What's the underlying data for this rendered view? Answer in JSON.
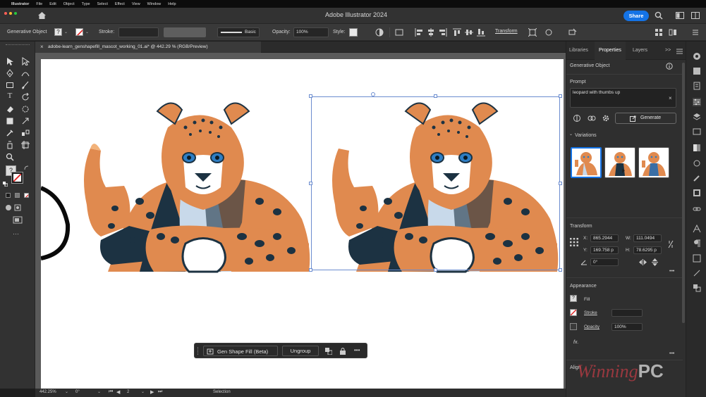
{
  "menubar": {
    "apple": "",
    "items": [
      "Illustrator",
      "File",
      "Edit",
      "Object",
      "Type",
      "Select",
      "Effect",
      "View",
      "Window",
      "Help"
    ]
  },
  "titlebar": {
    "title": "Adobe Illustrator 2024",
    "share_label": "Share"
  },
  "control_bar": {
    "selection_label": "Generative Object",
    "fill_glyph": "?",
    "stroke_label": "Stroke:",
    "brush_label": "Basic",
    "opacity_label": "Opacity:",
    "opacity_value": "100%",
    "style_label": "Style:",
    "transform_label": "Transform"
  },
  "document_tab": {
    "title": "adobe-learn_genshapefill_mascot_working_01.ai* @ 442.29 % (RGB/Preview)",
    "close": "×"
  },
  "toolbar": {
    "more": "···"
  },
  "context_bar": {
    "gen_label": "Gen Shape Fill (Beta)",
    "ungroup_label": "Ungroup",
    "more": "•••"
  },
  "statusbar": {
    "zoom": "442.25%",
    "rotation": "0°",
    "artboard_num": "2",
    "mode": "Selection"
  },
  "panel": {
    "tabs": [
      "Libraries",
      "Properties",
      "Layers"
    ],
    "active_tab": "Properties",
    "overflow": ">>",
    "section_title": "Generative Object",
    "prompt_label": "Prompt",
    "prompt_text": "leopard with thumbs up",
    "prompt_clear": "×",
    "generate_label": "Generate",
    "variations_label": "Variations",
    "transform_label": "Transform",
    "x_label": "X:",
    "x_value": "865.2944",
    "w_label": "W:",
    "w_value": "111.0494",
    "y_label": "Y:",
    "y_value": "169.758 p",
    "h_label": "H:",
    "h_value": "78.6295 p",
    "angle_value": "0°",
    "appearance_label": "Appearance",
    "fill_label": "Fill",
    "stroke_label": "Stroke",
    "opacity_label": "Opacity",
    "opacity_value": "100%",
    "fx_label": "fx.",
    "align_label": "Align",
    "more": "•••"
  },
  "watermark": {
    "text_a": "Winning",
    "text_b": "PC"
  },
  "colors": {
    "accent": "#1473e6",
    "leopard_orange": "#e08a4f",
    "leopard_dark": "#1c3242",
    "chest_blue": "#c8d9ea",
    "selection_blue": "#6b8ccf"
  }
}
